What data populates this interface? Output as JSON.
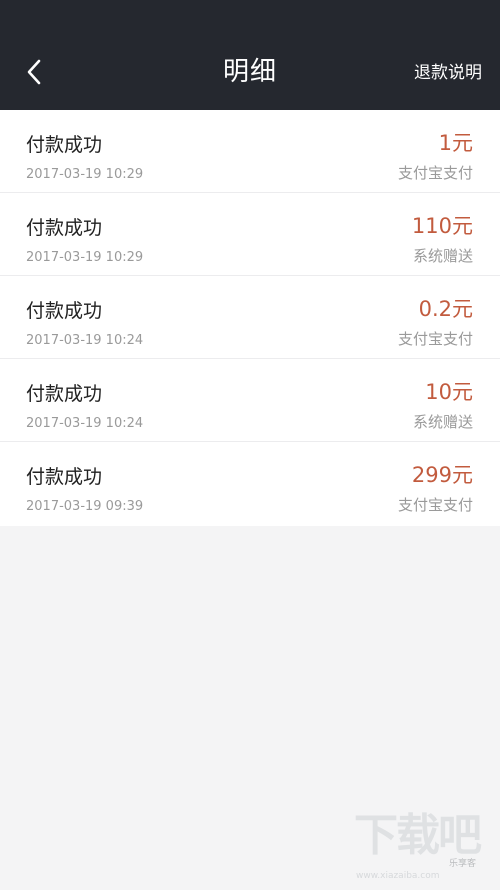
{
  "header": {
    "back_icon": "chevron-left-icon",
    "title": "明细",
    "refund_link": "退款说明"
  },
  "transactions": [
    {
      "status": "付款成功",
      "time": "2017-03-19 10:29",
      "amount": "1元",
      "method": "支付宝支付"
    },
    {
      "status": "付款成功",
      "time": "2017-03-19 10:29",
      "amount": "110元",
      "method": "系统赠送"
    },
    {
      "status": "付款成功",
      "time": "2017-03-19 10:24",
      "amount": "0.2元",
      "method": "支付宝支付"
    },
    {
      "status": "付款成功",
      "time": "2017-03-19 10:24",
      "amount": "10元",
      "method": "系统赠送"
    },
    {
      "status": "付款成功",
      "time": "2017-03-19 09:39",
      "amount": "299元",
      "method": "支付宝支付"
    }
  ],
  "watermark": {
    "logo_text": "下载吧",
    "url": "www.xiazaiba.com",
    "tag": "乐享客"
  },
  "colors": {
    "header_bg": "#25282f",
    "amount": "#c25b3e",
    "secondary_text": "#9a9a9a",
    "page_bg": "#f4f4f5"
  }
}
